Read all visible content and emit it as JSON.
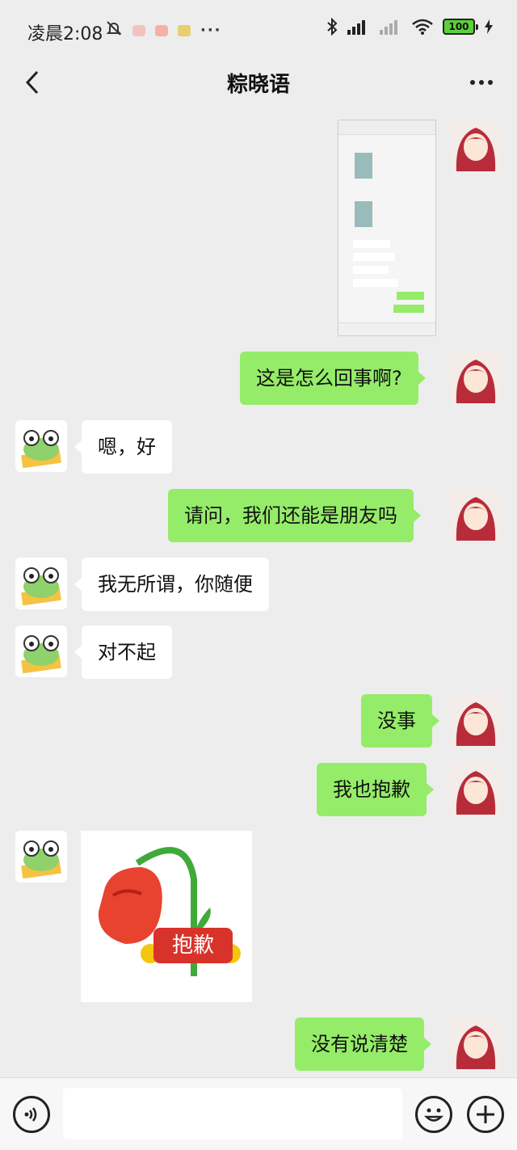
{
  "status_bar": {
    "time": "凌晨2:08",
    "battery": "100"
  },
  "header": {
    "title": "粽晓语"
  },
  "messages": [
    {
      "side": "right",
      "type": "image",
      "caption": ""
    },
    {
      "side": "right",
      "type": "text",
      "text": "这是怎么回事啊?"
    },
    {
      "side": "left",
      "type": "text",
      "text": "嗯，好"
    },
    {
      "side": "right",
      "type": "text",
      "text": "请问，我们还能是朋友吗"
    },
    {
      "side": "left",
      "type": "text",
      "text": "我无所谓，你随便"
    },
    {
      "side": "left",
      "type": "text",
      "text": "对不起"
    },
    {
      "side": "right",
      "type": "text",
      "text": "没事"
    },
    {
      "side": "right",
      "type": "text",
      "text": "我也抱歉"
    },
    {
      "side": "left",
      "type": "sticker",
      "text": "抱歉"
    },
    {
      "side": "right",
      "type": "text",
      "text": "没有说清楚"
    }
  ],
  "colors": {
    "background": "#ededed",
    "bubble_self": "#95ec69",
    "bubble_other": "#ffffff",
    "sticker_label": "#d8332a"
  },
  "icons": {
    "back": "chevron-left-icon",
    "more": "more-dots-icon",
    "voice": "voice-icon",
    "emoji": "emoji-icon",
    "plus": "plus-icon"
  }
}
